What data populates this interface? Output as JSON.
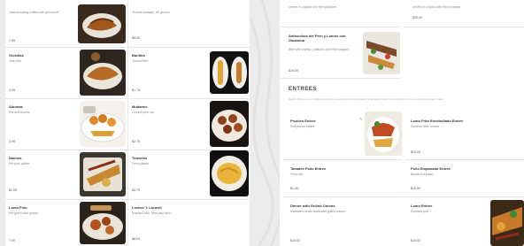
{
  "left": {
    "items": [
      {
        "name": "",
        "desc": "Jane dumpling stuffed with ground ref",
        "price": "7.95"
      },
      {
        "name": "",
        "desc": "Ground sausage, ref ground",
        "price": "$8.50"
      },
      {
        "name": "Guisillas",
        "desc": "Jedi pork",
        "price": "3.99"
      },
      {
        "name": "Barillos",
        "desc": "Grand fillers",
        "price": "$1.78"
      },
      {
        "name": "Albonas",
        "desc": "Ref and cheese",
        "price": "3.99"
      },
      {
        "name": "Mudanes",
        "desc": "Ground pork mix",
        "price": "$2.75"
      },
      {
        "name": "Nachos",
        "desc": "Ref pork platter",
        "price": "$1.00"
      },
      {
        "name": "Tomsens",
        "desc": "Fresh platter",
        "price": "$4.75"
      },
      {
        "name": "Lomo Foto",
        "desc": "Ref grand with spread",
        "price": "7.00"
      },
      {
        "name": "Lochee T. Lorowll",
        "desc": "Roasted pork, fried past fresh",
        "price": "$8.00"
      }
    ]
  },
  "right": {
    "top_items": [
      {
        "desc": "served in a tapas with fried potatoes",
        "price": ""
      },
      {
        "desc": "served in a tapas with fried potatoes",
        "price": "$20.00"
      }
    ],
    "featured": {
      "name": "Anticuchos del Peru y Lomos con Gaucama",
      "desc": "Beef with shrimp, potatoes and fresh peppers",
      "price": "$19.00"
    },
    "section": {
      "title": "ENTREES",
      "desc": "Hearty dishes of our traditional cuisine, served with rice and salad, all prepared fresh in our kitchen for you to share and enjoy today"
    },
    "entrees": [
      {
        "name": "Pozoles Entree",
        "desc": "Red pozole platter",
        "price": "$29.00"
      },
      {
        "name": "Lomo Frito Encebollado Entree",
        "desc": "Sauteed beef, onions",
        "price": "$19.00"
      },
      {
        "name": "Tamales Pollo Entree",
        "desc": "Fried rice",
        "price": "$1.50"
      },
      {
        "name": "Pollo Empanado Entree",
        "desc": "Breaded chicken",
        "price": "$15.00"
      },
      {
        "name": "Dinner with Grilled Onions",
        "desc": "Marinated sirloin steak with grilled onions",
        "price": "$19.00"
      },
      {
        "name": "Lomo Entree",
        "desc": "Roasted pork",
        "price": "$19.00"
      }
    ]
  },
  "icons": {
    "edit": "pencil-icon"
  }
}
